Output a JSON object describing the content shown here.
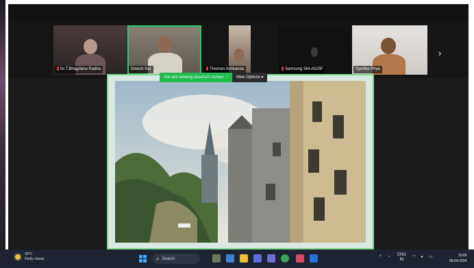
{
  "meeting": {
    "participants": [
      {
        "name": "Dr.T.Bhagdana Radha",
        "muted": true
      },
      {
        "name": "Dinesh Kar",
        "muted": false
      },
      {
        "name": "Thoman Ashkanda",
        "muted": true
      },
      {
        "name": "Samsung SM-A525F",
        "muted": true
      },
      {
        "name": "Syuhba Priya",
        "muted": false
      }
    ],
    "next_page_icon": "chevron-right-icon",
    "share_banner": {
      "text": "You are viewing Jessica's screen",
      "view_options": "View Options ▾"
    },
    "active_speaker_color": "#2fc86a",
    "banner_color": "#22b94f"
  },
  "taskbar": {
    "weather_line1": "30°C",
    "weather_line2": "Partly cloudy",
    "search_label": "Search",
    "tray_lang": "ENG",
    "tray_lang_sub": "IN",
    "clock_time": "10:05",
    "clock_date": "09-04-2024",
    "icons": [
      "task-view-icon",
      "file-explorer-icon",
      "edge-icon",
      "store-icon",
      "teams-icon",
      "chrome-icon",
      "photos-icon",
      "word-icon"
    ]
  }
}
